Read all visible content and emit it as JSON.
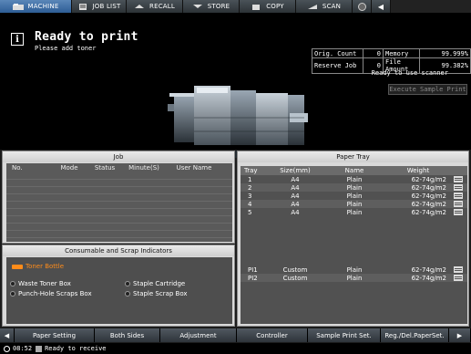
{
  "top_tabs": [
    {
      "label": "MACHINE",
      "icon": "machine-icon",
      "active": true
    },
    {
      "label": "JOB LIST",
      "icon": "joblist-icon",
      "active": false
    },
    {
      "label": "RECALL",
      "icon": "recall-icon",
      "active": false
    },
    {
      "label": "STORE",
      "icon": "store-icon",
      "active": false
    },
    {
      "label": "COPY",
      "icon": "copy-icon",
      "active": false
    },
    {
      "label": "SCAN",
      "icon": "scan-icon",
      "active": false
    }
  ],
  "status": {
    "main": "Ready to print",
    "sub": "Please add toner"
  },
  "info": {
    "orig_count_label": "Orig. Count",
    "orig_count": "0",
    "memory_label": "Memory",
    "memory": "99.999%",
    "reserve_job_label": "Reserve Job",
    "reserve_job": "0",
    "file_amount_label": "File Amount",
    "file_amount": "99.382%",
    "scanner_status": "Ready to use scanner",
    "exec_sample_print": "Execute Sample Print"
  },
  "job": {
    "title": "Job",
    "columns": [
      "No.",
      "Mode",
      "Status",
      "Minute(S)",
      "User Name"
    ]
  },
  "consumables": {
    "title": "Consumable and Scrap Indicators",
    "toner_bottle": "Toner Bottle",
    "waste_toner_box": "Waste Toner Box",
    "punch_hole_box": "Punch-Hole Scraps Box",
    "staple_cartridge": "Staple Cartridge",
    "staple_scrap_box": "Staple Scrap Box"
  },
  "paper_tray": {
    "title": "Paper Tray",
    "columns": [
      "Tray",
      "Size(mm)",
      "Name",
      "Weight"
    ],
    "rows": [
      {
        "tray": "1",
        "size": "A4",
        "name": "Plain",
        "weight": "62-74g/m2"
      },
      {
        "tray": "2",
        "size": "A4",
        "name": "Plain",
        "weight": "62-74g/m2"
      },
      {
        "tray": "3",
        "size": "A4",
        "name": "Plain",
        "weight": "62-74g/m2"
      },
      {
        "tray": "4",
        "size": "A4",
        "name": "Plain",
        "weight": "62-74g/m2"
      },
      {
        "tray": "5",
        "size": "A4",
        "name": "Plain",
        "weight": "62-74g/m2"
      }
    ],
    "pi_rows": [
      {
        "tray": "PI1",
        "size": "Custom",
        "name": "Plain",
        "weight": "62-74g/m2"
      },
      {
        "tray": "PI2",
        "size": "Custom",
        "name": "Plain",
        "weight": "62-74g/m2"
      }
    ]
  },
  "bottom_tabs": [
    "Paper Setting",
    "Both Sides",
    "Adjustment",
    "Controller",
    "Sample Print Set.",
    "Reg./Del.PaperSet."
  ],
  "statusbar": {
    "time": "08:52",
    "message": "Ready to receive"
  },
  "colors": {
    "active_tab": "#2d5d95",
    "toner_warning": "#ff8c1a"
  }
}
